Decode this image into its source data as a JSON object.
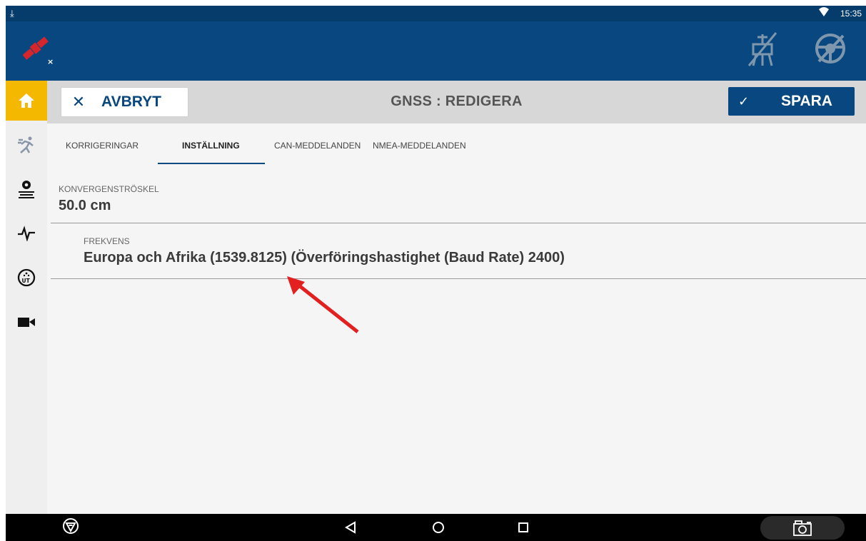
{
  "status_bar": {
    "time": "15:35"
  },
  "icons": {
    "download": "download-icon",
    "wifi": "wifi-icon",
    "satellite": "satellite-disconnected-icon",
    "implement": "implement-off-icon",
    "steering": "steering-off-icon",
    "home": "home-icon",
    "run": "run-icon",
    "settings": "gear-field-icon",
    "health": "pulse-icon",
    "ut": "universal-terminal-icon",
    "camera": "video-camera-icon"
  },
  "colors": {
    "header_blue": "#08477f",
    "status_blue": "#063c6b",
    "active_home": "#f5b800",
    "annotation_arrow": "#e32020"
  },
  "toolbar": {
    "cancel_label": "AVBRYT",
    "title": "GNSS  :  REDIGERA",
    "save_label": "SPARA"
  },
  "tabs": [
    {
      "label": "KORRIGERINGAR"
    },
    {
      "label": "INSTÄLLNING"
    },
    {
      "label": "CAN-MEDDELANDEN"
    },
    {
      "label": "NMEA-MEDDELANDEN"
    }
  ],
  "fields": {
    "convergence": {
      "label": "KONVERGENSTRÖSKEL",
      "value": "50.0 cm"
    },
    "frequency": {
      "label": "FREKVENS",
      "value": "Europa och Afrika (1539.8125) (Överföringshastighet (Baud Rate) 2400)"
    }
  }
}
